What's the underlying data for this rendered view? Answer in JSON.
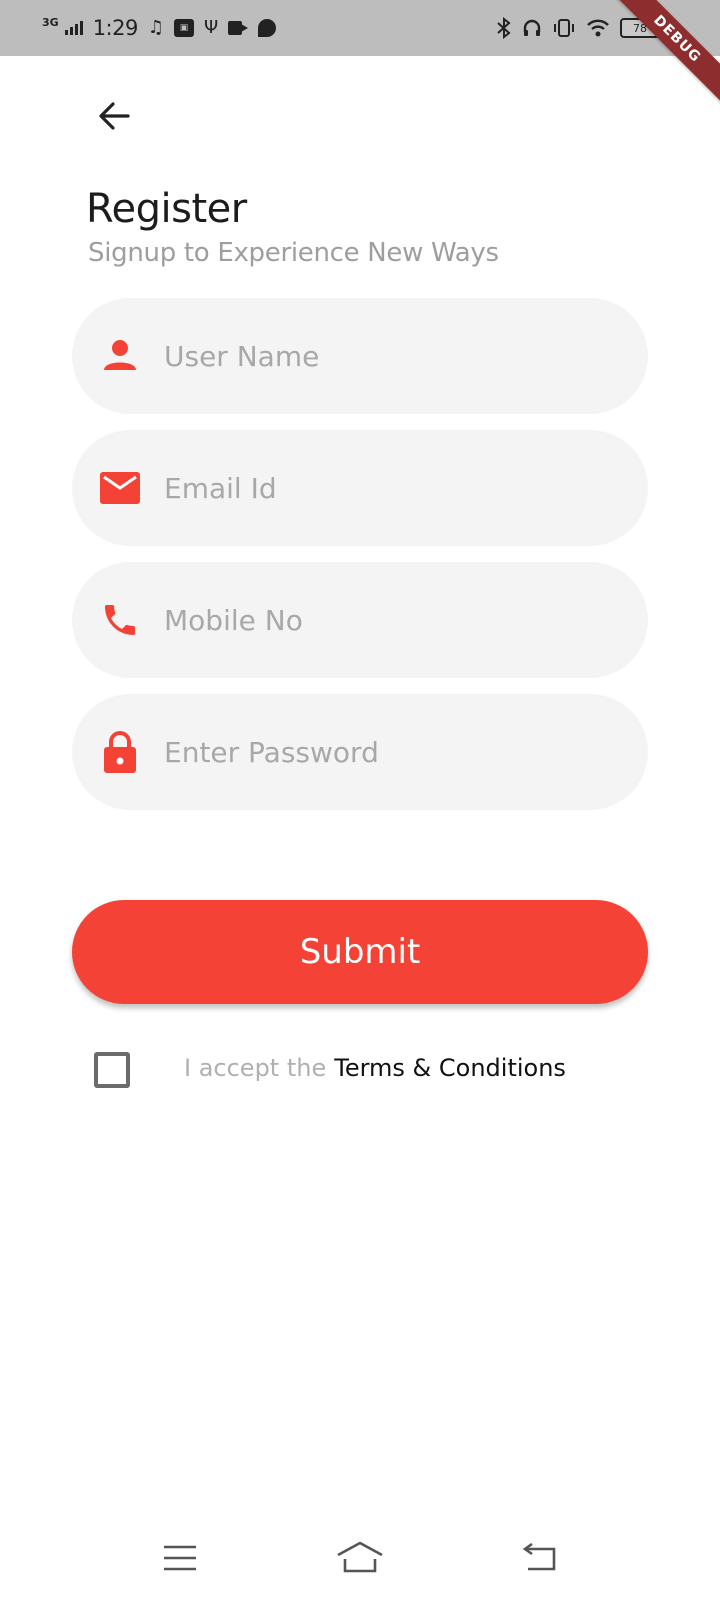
{
  "status_bar": {
    "network": "3G",
    "time": "1:29",
    "battery": "78"
  },
  "debug_banner": "DEBUG",
  "header": {
    "title": "Register",
    "subtitle": "Signup to Experience New Ways"
  },
  "form": {
    "username_placeholder": "User Name",
    "email_placeholder": "Email Id",
    "mobile_placeholder": "Mobile No",
    "password_placeholder": "Enter Password",
    "submit_label": "Submit"
  },
  "terms": {
    "prefix": "I accept the",
    "link": "Terms & Conditions",
    "checked": false
  },
  "colors": {
    "accent": "#f44336",
    "field_bg": "#f4f4f4",
    "placeholder": "#a8a8a8"
  },
  "icons": {
    "back": "arrow-left-icon",
    "username": "person-icon",
    "email": "mail-icon",
    "mobile": "phone-icon",
    "password": "lock-icon"
  }
}
